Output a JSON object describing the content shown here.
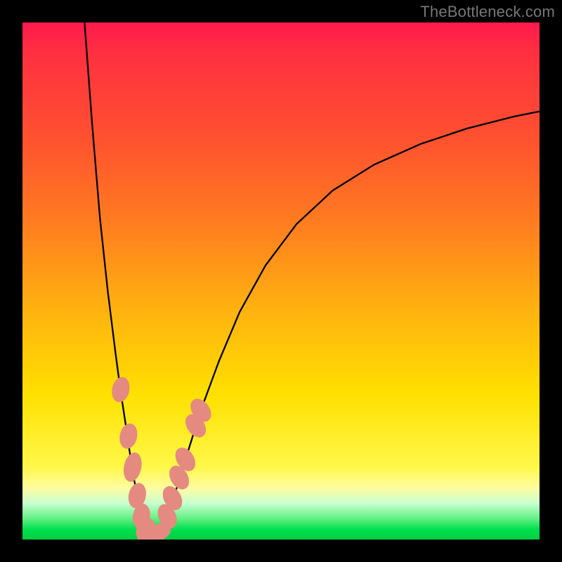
{
  "watermark": "TheBottleneck.com",
  "colors": {
    "curve_stroke": "#000000",
    "marker_fill": "#e58a80",
    "marker_stroke": "#e58a80"
  },
  "chart_data": {
    "type": "line",
    "title": "",
    "xlabel": "",
    "ylabel": "",
    "xlim": [
      0,
      100
    ],
    "ylim": [
      0,
      100
    ],
    "curve_left": {
      "x": [
        12.0,
        13.5,
        15.0,
        16.5,
        18.0,
        19.0,
        20.0,
        20.8,
        21.5,
        22.2,
        22.8,
        23.4,
        24.0,
        24.5,
        25.0
      ],
      "y": [
        100.0,
        80.0,
        62.0,
        48.0,
        36.0,
        28.5,
        22.0,
        16.5,
        12.0,
        8.5,
        5.5,
        3.5,
        2.0,
        1.0,
        0.5
      ]
    },
    "curve_right": {
      "x": [
        25.0,
        26.0,
        27.0,
        28.5,
        30.0,
        32.0,
        34.5,
        38.0,
        42.0,
        47.0,
        53.0,
        60.0,
        68.0,
        77.0,
        86.0,
        95.0,
        100.0
      ],
      "y": [
        0.5,
        1.2,
        3.0,
        6.0,
        10.5,
        17.0,
        25.0,
        34.5,
        44.0,
        53.0,
        61.0,
        67.5,
        72.5,
        76.5,
        79.5,
        81.8,
        82.8
      ]
    },
    "markers": [
      {
        "x": 19.0,
        "y": 29.0,
        "rx": 1.6,
        "ry": 2.4,
        "rot": 12
      },
      {
        "x": 20.5,
        "y": 20.0,
        "rx": 1.6,
        "ry": 2.4,
        "rot": 12
      },
      {
        "x": 21.3,
        "y": 14.0,
        "rx": 1.6,
        "ry": 2.8,
        "rot": 12
      },
      {
        "x": 22.2,
        "y": 8.5,
        "rx": 1.6,
        "ry": 2.4,
        "rot": 12
      },
      {
        "x": 23.0,
        "y": 4.5,
        "rx": 1.6,
        "ry": 2.4,
        "rot": 10
      },
      {
        "x": 23.8,
        "y": 2.0,
        "rx": 1.6,
        "ry": 2.2,
        "rot": 30
      },
      {
        "x": 24.8,
        "y": 0.6,
        "rx": 2.6,
        "ry": 1.5,
        "rot": 0
      },
      {
        "x": 26.5,
        "y": 1.5,
        "rx": 2.2,
        "ry": 1.5,
        "rot": -20
      },
      {
        "x": 28.0,
        "y": 4.5,
        "rx": 1.6,
        "ry": 2.4,
        "rot": -25
      },
      {
        "x": 29.0,
        "y": 8.0,
        "rx": 1.6,
        "ry": 2.4,
        "rot": -28
      },
      {
        "x": 30.3,
        "y": 12.0,
        "rx": 1.6,
        "ry": 2.4,
        "rot": -30
      },
      {
        "x": 31.5,
        "y": 15.5,
        "rx": 1.6,
        "ry": 2.4,
        "rot": -32
      },
      {
        "x": 33.5,
        "y": 22.0,
        "rx": 1.6,
        "ry": 2.4,
        "rot": -35
      },
      {
        "x": 34.5,
        "y": 25.0,
        "rx": 1.6,
        "ry": 2.4,
        "rot": -37
      }
    ]
  }
}
